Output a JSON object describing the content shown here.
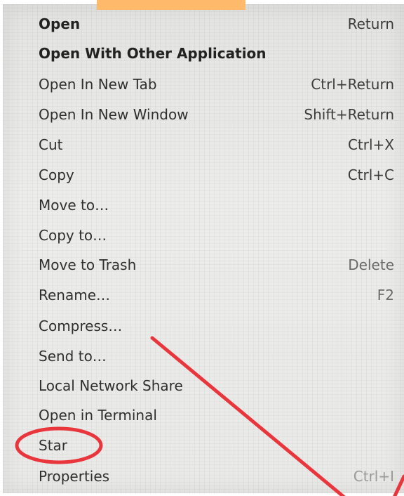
{
  "context_menu": {
    "items": [
      {
        "label": "Open",
        "shortcut": "Return"
      },
      {
        "label": "Open With Other Application",
        "shortcut": ""
      },
      {
        "label": "Open In New Tab",
        "shortcut": "Ctrl+Return"
      },
      {
        "label": "Open In New Window",
        "shortcut": "Shift+Return"
      },
      {
        "label": "Cut",
        "shortcut": "Ctrl+X"
      },
      {
        "label": "Copy",
        "shortcut": "Ctrl+C"
      },
      {
        "label": "Move to…",
        "shortcut": ""
      },
      {
        "label": "Copy to…",
        "shortcut": ""
      },
      {
        "label": "Move to Trash",
        "shortcut": "Delete"
      },
      {
        "label": "Rename…",
        "shortcut": "F2"
      },
      {
        "label": "Compress…",
        "shortcut": ""
      },
      {
        "label": "Send to…",
        "shortcut": ""
      },
      {
        "label": "Local Network Share",
        "shortcut": ""
      },
      {
        "label": "Open in Terminal",
        "shortcut": ""
      },
      {
        "label": "Star",
        "shortcut": ""
      },
      {
        "label": "Properties",
        "shortcut": "Ctrl+I"
      }
    ]
  },
  "colors": {
    "top_tab": "#ffb96a",
    "annotation_red": "#e8363c",
    "menu_background": "#e9e9e7"
  },
  "annotations": {
    "highlighted_item": "Star",
    "marks": [
      "red-ellipse-circle",
      "red-diagonal-line"
    ]
  }
}
